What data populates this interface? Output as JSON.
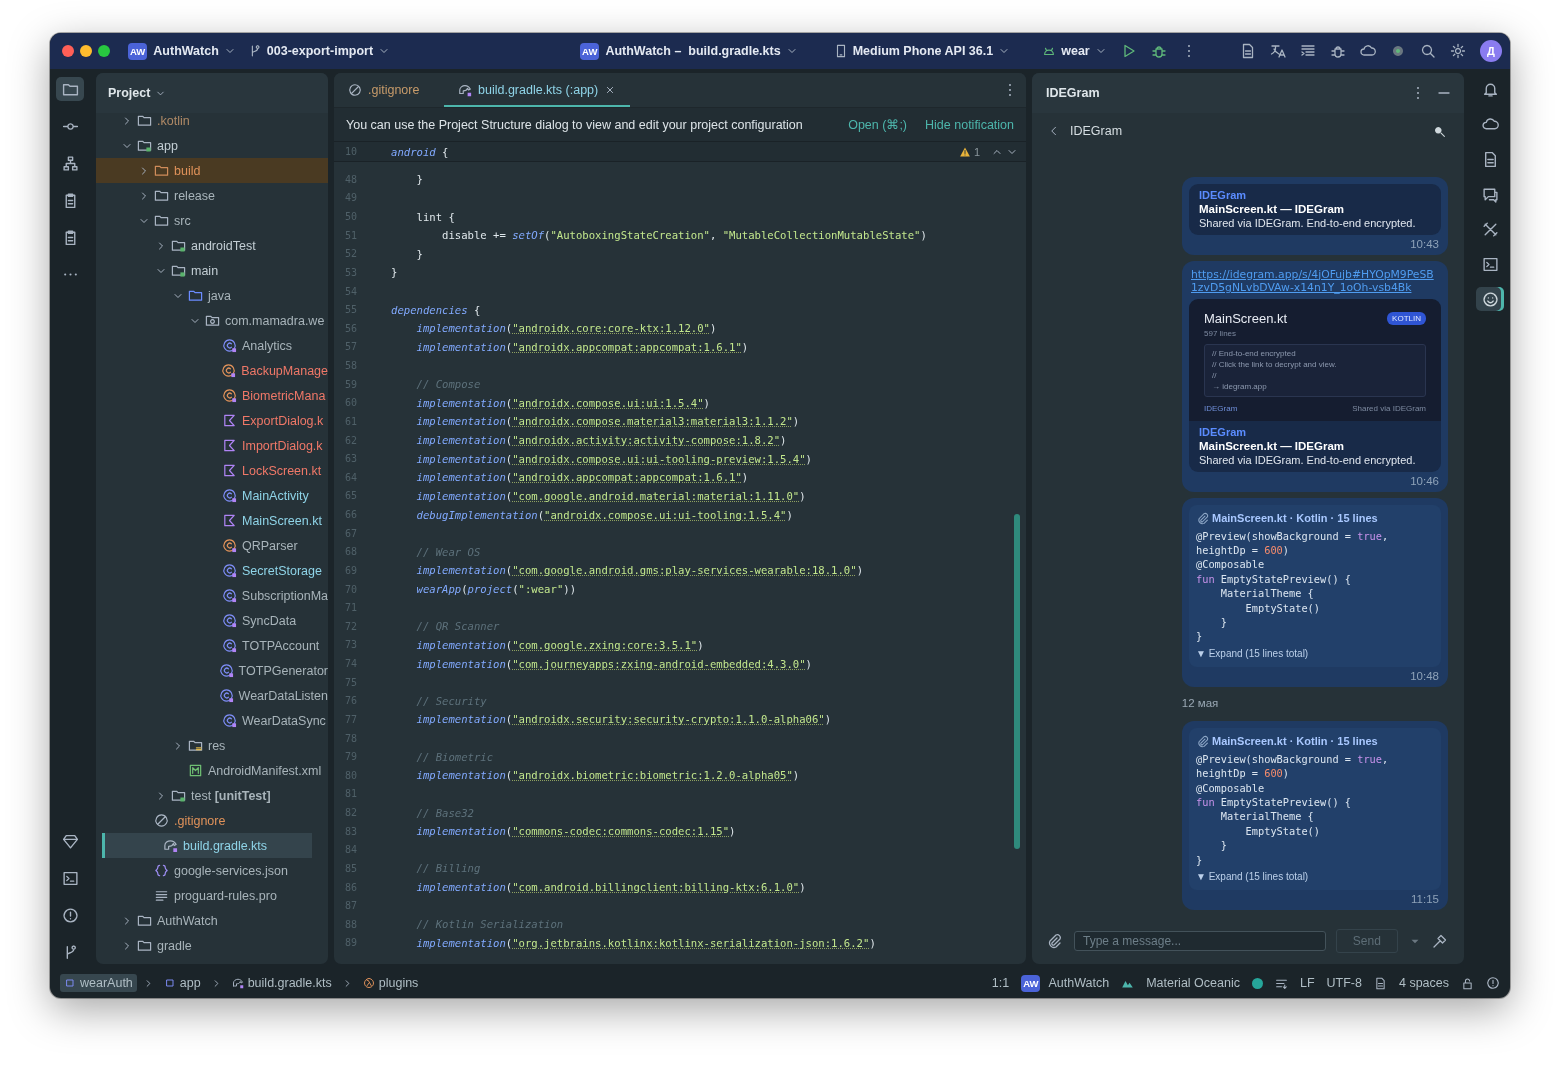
{
  "title_bar": {
    "project_badge": "AW",
    "project": "AuthWatch",
    "branch": "003-export-import",
    "file_badge": "AW",
    "file_project": "AuthWatch –",
    "file": "build.gradle.kts",
    "device": "Medium Phone API 36.1",
    "run_config": "wear",
    "user_initial": "Д"
  },
  "project_panel": {
    "title": "Project",
    "tree": [
      {
        "label": ".kotlin",
        "kind": "folder",
        "color": "#b08a66",
        "selected": false,
        "expanded": false
      },
      {
        "label": "app",
        "kind": "module",
        "color": "#c3ced4",
        "selected": false,
        "expanded": true,
        "children": [
          {
            "label": "build",
            "kind": "excluded-folder",
            "color": "#e0925a",
            "selected": false,
            "expanded": false
          },
          {
            "label": "release",
            "kind": "folder",
            "color": "#a8b4ba",
            "selected": false,
            "expanded": false
          },
          {
            "label": "src",
            "kind": "folder",
            "color": "#a8b4ba",
            "selected": false,
            "expanded": true,
            "children": [
              {
                "label": "androidTest",
                "kind": "module",
                "color": "#c3ced4",
                "selected": false,
                "expanded": false
              },
              {
                "label": "main",
                "kind": "module",
                "color": "#c3ced4",
                "selected": false,
                "expanded": true,
                "children": [
                  {
                    "label": "java",
                    "kind": "source-folder",
                    "color": "#a8b4ba",
                    "selected": false,
                    "expanded": true,
                    "children": [
                      {
                        "label": "com.mamadra.we",
                        "kind": "package",
                        "color": "#a8b4ba",
                        "selected": false,
                        "expanded": true,
                        "children": [
                          {
                            "label": "Analytics",
                            "kind": "class",
                            "color": "#a8b4ba",
                            "selected": false
                          },
                          {
                            "label": "BackupManage",
                            "kind": "object",
                            "color": "#f07868",
                            "selected": false
                          },
                          {
                            "label": "BiometricMana",
                            "kind": "object",
                            "color": "#f07868",
                            "selected": false
                          },
                          {
                            "label": "ExportDialog.k",
                            "kind": "kotlin-file",
                            "color": "#f07868",
                            "selected": false
                          },
                          {
                            "label": "ImportDialog.k",
                            "kind": "kotlin-file",
                            "color": "#f07868",
                            "selected": false
                          },
                          {
                            "label": "LockScreen.kt",
                            "kind": "kotlin-file",
                            "color": "#f07868",
                            "selected": false
                          },
                          {
                            "label": "MainActivity",
                            "kind": "class",
                            "color": "#8fd4e8",
                            "selected": false
                          },
                          {
                            "label": "MainScreen.kt",
                            "kind": "kotlin-file",
                            "color": "#8fd4e8",
                            "selected": false
                          },
                          {
                            "label": "QRParser",
                            "kind": "object",
                            "color": "#a8b4ba",
                            "selected": false
                          },
                          {
                            "label": "SecretStorage",
                            "kind": "class",
                            "color": "#8fd4e8",
                            "selected": false
                          },
                          {
                            "label": "SubscriptionMa",
                            "kind": "class",
                            "color": "#a8b4ba",
                            "selected": false
                          },
                          {
                            "label": "SyncData",
                            "kind": "class",
                            "color": "#a8b4ba",
                            "selected": false
                          },
                          {
                            "label": "TOTPAccount",
                            "kind": "class",
                            "color": "#a8b4ba",
                            "selected": false
                          },
                          {
                            "label": "TOTPGenerator",
                            "kind": "class",
                            "color": "#a8b4ba",
                            "selected": false
                          },
                          {
                            "label": "WearDataListen",
                            "kind": "class",
                            "color": "#a8b4ba",
                            "selected": false
                          },
                          {
                            "label": "WearDataSync",
                            "kind": "class",
                            "color": "#a8b4ba",
                            "selected": false
                          }
                        ]
                      }
                    ]
                  },
                  {
                    "label": "res",
                    "kind": "resource-folder",
                    "color": "#a8b4ba",
                    "selected": false,
                    "expanded": false
                  },
                  {
                    "label": "AndroidManifest.xml",
                    "kind": "manifest",
                    "color": "#a8b4ba",
                    "selected": false
                  }
                ]
              },
              {
                "label": "test **[unitTest]**",
                "kind": "module",
                "color": "#a8b4ba",
                "selected": false,
                "expanded": false
              }
            ]
          },
          {
            "label": ".gitignore",
            "kind": "ignore-file",
            "color": "#e0925a",
            "selected": false
          },
          {
            "label": "build.gradle.kts",
            "kind": "gradle-file",
            "color": "#8fd4e8",
            "selected": true
          },
          {
            "label": "google-services.json",
            "kind": "json-file",
            "color": "#a8b4ba",
            "selected": false
          },
          {
            "label": "proguard-rules.pro",
            "kind": "text-file",
            "color": "#a8b4ba",
            "selected": false
          }
        ]
      },
      {
        "label": "AuthWatch",
        "kind": "folder",
        "color": "#a8b4ba",
        "selected": false,
        "expanded": false
      },
      {
        "label": "gradle",
        "kind": "folder",
        "color": "#a8b4ba",
        "selected": false,
        "expanded": false
      }
    ]
  },
  "editor": {
    "tabs": [
      {
        "label": ".gitignore",
        "kind": "ignore-file",
        "selected": false
      },
      {
        "label": "build.gradle.kts (:app)",
        "kind": "gradle-file",
        "selected": true
      }
    ],
    "notification": {
      "text": "You can use the Project Structure dialog to view and edit your project configuration",
      "actions": [
        "Open (⌘;)",
        "Hide notification"
      ]
    },
    "warning_count": "1",
    "sticky_line": {
      "number": "10",
      "tokens": [
        {
          "text": "android",
          "kind": "call"
        },
        {
          "text": " {",
          "kind": "plain"
        }
      ]
    },
    "lines": [
      {
        "number": "48",
        "tokens": [
          {
            "text": "    }",
            "kind": "plain"
          }
        ]
      },
      {
        "number": "49"
      },
      {
        "number": "50",
        "tokens": [
          {
            "text": "    lint {",
            "kind": "plain"
          }
        ]
      },
      {
        "number": "51",
        "tokens": [
          {
            "text": "        disable += ",
            "kind": "plain"
          },
          {
            "text": "setOf",
            "kind": "call"
          },
          {
            "text": "(",
            "kind": "plain"
          },
          {
            "text": "\"AutoboxingStateCreation\"",
            "kind": "string"
          },
          {
            "text": ", ",
            "kind": "plain"
          },
          {
            "text": "\"MutableCollectionMutableState\"",
            "kind": "string"
          },
          {
            "text": ")",
            "kind": "plain"
          }
        ]
      },
      {
        "number": "52",
        "tokens": [
          {
            "text": "    }",
            "kind": "plain"
          }
        ]
      },
      {
        "number": "53",
        "tokens": [
          {
            "text": "}",
            "kind": "plain"
          }
        ]
      },
      {
        "number": "54"
      },
      {
        "number": "55",
        "tokens": [
          {
            "text": "dependencies",
            "kind": "call"
          },
          {
            "text": " {",
            "kind": "plain"
          }
        ]
      },
      {
        "number": "56",
        "tokens": [
          {
            "text": "    implementation",
            "kind": "call"
          },
          {
            "text": "(",
            "kind": "plain"
          },
          {
            "text": "\"androidx.core:core-ktx:1.12.0\"",
            "kind": "dependency"
          },
          {
            "text": ")",
            "kind": "plain"
          }
        ]
      },
      {
        "number": "57",
        "tokens": [
          {
            "text": "    implementation",
            "kind": "call"
          },
          {
            "text": "(",
            "kind": "plain"
          },
          {
            "text": "\"androidx.appcompat:appcompat:1.6.1\"",
            "kind": "dependency"
          },
          {
            "text": ")",
            "kind": "plain"
          }
        ]
      },
      {
        "number": "58"
      },
      {
        "number": "59",
        "tokens": [
          {
            "text": "    // Compose",
            "kind": "comment"
          }
        ]
      },
      {
        "number": "60",
        "tokens": [
          {
            "text": "    implementation",
            "kind": "call"
          },
          {
            "text": "(",
            "kind": "plain"
          },
          {
            "text": "\"androidx.compose.ui:ui:1.5.4\"",
            "kind": "dependency"
          },
          {
            "text": ")",
            "kind": "plain"
          }
        ]
      },
      {
        "number": "61",
        "tokens": [
          {
            "text": "    implementation",
            "kind": "call"
          },
          {
            "text": "(",
            "kind": "plain"
          },
          {
            "text": "\"androidx.compose.material3:material3:1.1.2\"",
            "kind": "dependency"
          },
          {
            "text": ")",
            "kind": "plain"
          }
        ]
      },
      {
        "number": "62",
        "tokens": [
          {
            "text": "    implementation",
            "kind": "call"
          },
          {
            "text": "(",
            "kind": "plain"
          },
          {
            "text": "\"androidx.activity:activity-compose:1.8.2\"",
            "kind": "dependency"
          },
          {
            "text": ")",
            "kind": "plain"
          }
        ]
      },
      {
        "number": "63",
        "tokens": [
          {
            "text": "    implementation",
            "kind": "call"
          },
          {
            "text": "(",
            "kind": "plain"
          },
          {
            "text": "\"androidx.compose.ui:ui-tooling-preview:1.5.4\"",
            "kind": "dependency"
          },
          {
            "text": ")",
            "kind": "plain"
          }
        ]
      },
      {
        "number": "64",
        "tokens": [
          {
            "text": "    implementation",
            "kind": "call"
          },
          {
            "text": "(",
            "kind": "plain"
          },
          {
            "text": "\"androidx.appcompat:appcompat:1.6.1\"",
            "kind": "dependency"
          },
          {
            "text": ")",
            "kind": "plain"
          }
        ]
      },
      {
        "number": "65",
        "tokens": [
          {
            "text": "    implementation",
            "kind": "call"
          },
          {
            "text": "(",
            "kind": "plain"
          },
          {
            "text": "\"com.google.android.material:material:1.11.0\"",
            "kind": "dependency"
          },
          {
            "text": ")",
            "kind": "plain"
          }
        ]
      },
      {
        "number": "66",
        "tokens": [
          {
            "text": "    debugImplementation",
            "kind": "call"
          },
          {
            "text": "(",
            "kind": "plain"
          },
          {
            "text": "\"androidx.compose.ui:ui-tooling:1.5.4\"",
            "kind": "dependency"
          },
          {
            "text": ")",
            "kind": "plain"
          }
        ]
      },
      {
        "number": "67"
      },
      {
        "number": "68",
        "tokens": [
          {
            "text": "    // Wear OS",
            "kind": "comment"
          }
        ]
      },
      {
        "number": "69",
        "tokens": [
          {
            "text": "    implementation",
            "kind": "call"
          },
          {
            "text": "(",
            "kind": "plain"
          },
          {
            "text": "\"com.google.android.gms:play-services-wearable:18.1.0\"",
            "kind": "dependency"
          },
          {
            "text": ")",
            "kind": "plain"
          }
        ]
      },
      {
        "number": "70",
        "tokens": [
          {
            "text": "    wearApp",
            "kind": "call"
          },
          {
            "text": "(",
            "kind": "plain"
          },
          {
            "text": "project",
            "kind": "call"
          },
          {
            "text": "(",
            "kind": "plain"
          },
          {
            "text": "\":wear\"",
            "kind": "string"
          },
          {
            "text": "))",
            "kind": "plain"
          }
        ]
      },
      {
        "number": "71"
      },
      {
        "number": "72",
        "tokens": [
          {
            "text": "    // QR Scanner",
            "kind": "comment"
          }
        ]
      },
      {
        "number": "73",
        "tokens": [
          {
            "text": "    implementation",
            "kind": "call"
          },
          {
            "text": "(",
            "kind": "plain"
          },
          {
            "text": "\"com.google.zxing:core:3.5.1\"",
            "kind": "dependency"
          },
          {
            "text": ")",
            "kind": "plain"
          }
        ]
      },
      {
        "number": "74",
        "tokens": [
          {
            "text": "    implementation",
            "kind": "call"
          },
          {
            "text": "(",
            "kind": "plain"
          },
          {
            "text": "\"com.journeyapps:zxing-android-embedded:4.3.0\"",
            "kind": "dependency"
          },
          {
            "text": ")",
            "kind": "plain"
          }
        ]
      },
      {
        "number": "75"
      },
      {
        "number": "76",
        "tokens": [
          {
            "text": "    // Security",
            "kind": "comment"
          }
        ]
      },
      {
        "number": "77",
        "tokens": [
          {
            "text": "    implementation",
            "kind": "call"
          },
          {
            "text": "(",
            "kind": "plain"
          },
          {
            "text": "\"androidx.security:security-crypto:1.1.0-alpha06\"",
            "kind": "dependency"
          },
          {
            "text": ")",
            "kind": "plain"
          }
        ]
      },
      {
        "number": "78"
      },
      {
        "number": "79",
        "tokens": [
          {
            "text": "    // Biometric",
            "kind": "comment"
          }
        ]
      },
      {
        "number": "80",
        "tokens": [
          {
            "text": "    implementation",
            "kind": "call"
          },
          {
            "text": "(",
            "kind": "plain"
          },
          {
            "text": "\"androidx.biometric:biometric:1.2.0-alpha05\"",
            "kind": "dependency"
          },
          {
            "text": ")",
            "kind": "plain"
          }
        ]
      },
      {
        "number": "81"
      },
      {
        "number": "82",
        "tokens": [
          {
            "text": "    // Base32",
            "kind": "comment"
          }
        ]
      },
      {
        "number": "83",
        "tokens": [
          {
            "text": "    implementation",
            "kind": "call"
          },
          {
            "text": "(",
            "kind": "plain"
          },
          {
            "text": "\"commons-codec:commons-codec:1.15\"",
            "kind": "dependency"
          },
          {
            "text": ")",
            "kind": "plain"
          }
        ]
      },
      {
        "number": "84"
      },
      {
        "number": "85",
        "tokens": [
          {
            "text": "    // Billing",
            "kind": "comment"
          }
        ]
      },
      {
        "number": "86",
        "tokens": [
          {
            "text": "    implementation",
            "kind": "call"
          },
          {
            "text": "(",
            "kind": "plain"
          },
          {
            "text": "\"com.android.billingclient:billing-ktx:6.1.0\"",
            "kind": "dependency"
          },
          {
            "text": ")",
            "kind": "plain"
          }
        ]
      },
      {
        "number": "87"
      },
      {
        "number": "88",
        "tokens": [
          {
            "text": "    // Kotlin Serialization",
            "kind": "comment"
          }
        ]
      },
      {
        "number": "89",
        "tokens": [
          {
            "text": "    implementation",
            "kind": "call"
          },
          {
            "text": "(",
            "kind": "plain"
          },
          {
            "text": "\"org.jetbrains.kotlinx:kotlinx-serialization-json:1.6.2\"",
            "kind": "dependency"
          },
          {
            "text": ")",
            "kind": "plain"
          }
        ]
      }
    ]
  },
  "chat_panel": {
    "title": "IDEGram",
    "chat_name": "IDEGram",
    "messages": [
      {
        "kind": "share",
        "sender": "IDEGram",
        "title": "MainScreen.kt — IDEGram",
        "description": "Shared via IDEGram. End-to-end encrypted.",
        "time": "10:43"
      },
      {
        "kind": "link",
        "link": "https://idegram.app/s/4jOFujb#HYOpM9PeSB1zvD5gNLvbDVAw-x14n1Y_1oOh-vsb4Bk",
        "preview": {
          "title": "MainScreen.kt",
          "badge": "KOTLIN",
          "subtitle": "597 lines",
          "code": [
            "// End-to-end encrypted",
            "// Click the link to decrypt and view.",
            "//",
            "→ idegram.app"
          ],
          "footer_left": "IDEGram",
          "footer_right": "Shared via IDEGram"
        },
        "sender": "IDEGram",
        "title": "MainScreen.kt — IDEGram",
        "description": "Shared via IDEGram. End-to-end encrypted.",
        "time": "10:46"
      },
      {
        "kind": "code",
        "header": "MainScreen.kt · Kotlin · 15 lines",
        "lines": [
          [
            {
              "text": "@Preview(showBackground = ",
              "kind": "plain"
            },
            {
              "text": "true",
              "kind": "keyword"
            },
            {
              "text": ",",
              "kind": "plain"
            }
          ],
          [
            {
              "text": "heightDp = ",
              "kind": "plain"
            },
            {
              "text": "600",
              "kind": "number"
            },
            {
              "text": ")",
              "kind": "plain"
            }
          ],
          [
            {
              "text": "@Composable",
              "kind": "plain"
            }
          ],
          [
            {
              "text": "fun",
              "kind": "keyword"
            },
            {
              "text": " EmptyStatePreview() {",
              "kind": "plain"
            }
          ],
          [
            {
              "text": "    MaterialTheme {",
              "kind": "plain"
            }
          ],
          [
            {
              "text": "        EmptyState()",
              "kind": "plain"
            }
          ],
          [
            {
              "text": "    }",
              "kind": "plain"
            }
          ],
          [
            {
              "text": "}",
              "kind": "plain"
            }
          ]
        ],
        "expand": "▼ Expand (15 lines total)",
        "time": "10:48"
      },
      {
        "kind": "date",
        "text": "12 мая"
      },
      {
        "kind": "code",
        "header": "MainScreen.kt · Kotlin · 15 lines",
        "lines": [
          [
            {
              "text": "@Preview(showBackground = ",
              "kind": "plain"
            },
            {
              "text": "true",
              "kind": "keyword"
            },
            {
              "text": ",",
              "kind": "plain"
            }
          ],
          [
            {
              "text": "heightDp = ",
              "kind": "plain"
            },
            {
              "text": "600",
              "kind": "number"
            },
            {
              "text": ")",
              "kind": "plain"
            }
          ],
          [
            {
              "text": "@Composable",
              "kind": "plain"
            }
          ],
          [
            {
              "text": "fun",
              "kind": "keyword"
            },
            {
              "text": " EmptyStatePreview() {",
              "kind": "plain"
            }
          ],
          [
            {
              "text": "    MaterialTheme {",
              "kind": "plain"
            }
          ],
          [
            {
              "text": "        EmptyState()",
              "kind": "plain"
            }
          ],
          [
            {
              "text": "    }",
              "kind": "plain"
            }
          ],
          [
            {
              "text": "}",
              "kind": "plain"
            }
          ]
        ],
        "expand": "▼ Expand (15 lines total)",
        "time": "11:15"
      }
    ],
    "input": {
      "placeholder": "Type a message..."
    },
    "send": "Send"
  },
  "status_bar": {
    "breadcrumbs": [
      {
        "label": "wearAuth",
        "kind": "module",
        "selected": true
      },
      {
        "label": "app",
        "kind": "module",
        "selected": false
      },
      {
        "label": "build.gradle.kts",
        "kind": "gradle-file",
        "selected": false
      },
      {
        "label": "plugins",
        "kind": "lambda",
        "selected": false
      }
    ],
    "position": "1:1",
    "project_badge": "AW",
    "project": "AuthWatch",
    "theme": "Material Oceanic",
    "line_separator": "LF",
    "encoding": "UTF-8",
    "indent": "4 spaces"
  }
}
